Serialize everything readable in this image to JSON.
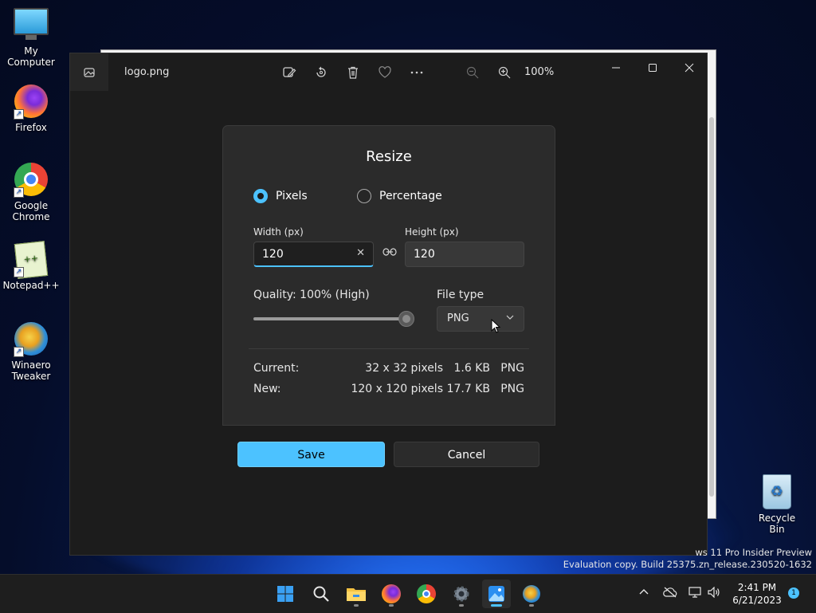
{
  "desktop": {
    "icons": [
      {
        "label": "My Computer"
      },
      {
        "label": "Firefox"
      },
      {
        "label": "Google\nChrome"
      },
      {
        "label": "Notepad++"
      },
      {
        "label": "Winaero\nTweaker"
      }
    ],
    "recycle_bin": "Recycle Bin",
    "watermark_line1": "ws 11 Pro Insider Preview",
    "watermark_line2": "Evaluation copy. Build 25375.zn_release.230520-1632"
  },
  "app": {
    "filename": "logo.png",
    "zoom": "100%",
    "toolbar": [
      "edit-image-icon",
      "rotate-icon",
      "delete-icon",
      "favorite-icon",
      "more-icon",
      "zoom-out-icon",
      "zoom-in-icon"
    ]
  },
  "resize_dialog": {
    "title": "Resize",
    "mode_options": [
      {
        "label": "Pixels",
        "selected": true
      },
      {
        "label": "Percentage",
        "selected": false
      }
    ],
    "width_label": "Width  (px)",
    "width_value": "120",
    "height_label": "Height  (px)",
    "height_value": "120",
    "quality_label": "Quality: 100% (High)",
    "quality_value": 1.0,
    "file_type_label": "File type",
    "file_type_value": "PNG",
    "current": {
      "label": "Current:",
      "dimensions": "32 x 32 pixels",
      "size": "1.6 KB",
      "type": "PNG"
    },
    "new": {
      "label": "New:",
      "dimensions": "120 x 120 pixels",
      "size": "17.7 KB",
      "type": "PNG"
    },
    "save_label": "Save",
    "cancel_label": "Cancel"
  },
  "taskbar": {
    "time": "2:41 PM",
    "date": "6/21/2023",
    "notification_count": "1"
  },
  "colors": {
    "accent": "#4cc2ff",
    "dialog_bg": "#2b2b2b",
    "app_bg": "#1c1c1c"
  }
}
